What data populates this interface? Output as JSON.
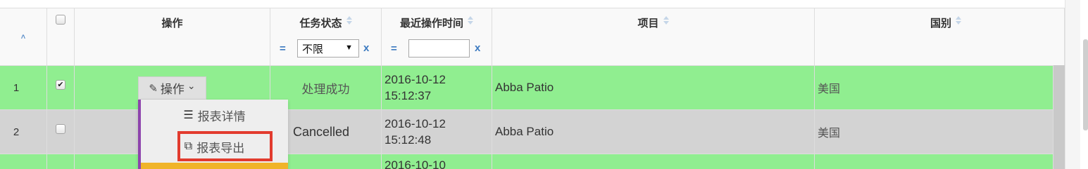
{
  "header": {
    "collapse_icon": "chevron-up-icon",
    "collapse_glyph": "˄",
    "col_operation": "操作",
    "col_status": "任务状态",
    "col_time": "最近操作时间",
    "col_project": "项目",
    "col_country": "国别"
  },
  "filters": {
    "eq_symbol": "=",
    "clear_symbol": "x",
    "status_value": "不限",
    "status_arrow": "▼",
    "time_value": ""
  },
  "rows": [
    {
      "index": "1",
      "checked": "✔",
      "status": "处理成功",
      "time_line1": "2016-10-12",
      "time_line2": "15:12:37",
      "project": "Abba Patio",
      "country": "美国",
      "color": "#90ee90"
    },
    {
      "index": "2",
      "checked": "",
      "status": "Cancelled",
      "time_line1": "2016-10-12",
      "time_line2": "15:12:48",
      "project": "Abba Patio",
      "country": "美国",
      "color": "#d3d3d3"
    },
    {
      "index": "",
      "checked": "",
      "status": "",
      "time_line1": "2016-10-10",
      "time_line2": "",
      "project": "",
      "country": "",
      "color": "#90ee90"
    }
  ],
  "ops_button": {
    "icon": "edit-icon",
    "icon_glyph": "✎",
    "label": "操作",
    "caret": "⌄"
  },
  "dropdown": {
    "items": [
      {
        "icon": "list-icon",
        "icon_glyph": "☰",
        "label": "报表详情"
      },
      {
        "icon": "external-link-icon",
        "icon_glyph": "⧉",
        "label": "报表导出"
      }
    ],
    "accent_color": "#8e44ad",
    "highlight_color": "#e23b2e"
  }
}
